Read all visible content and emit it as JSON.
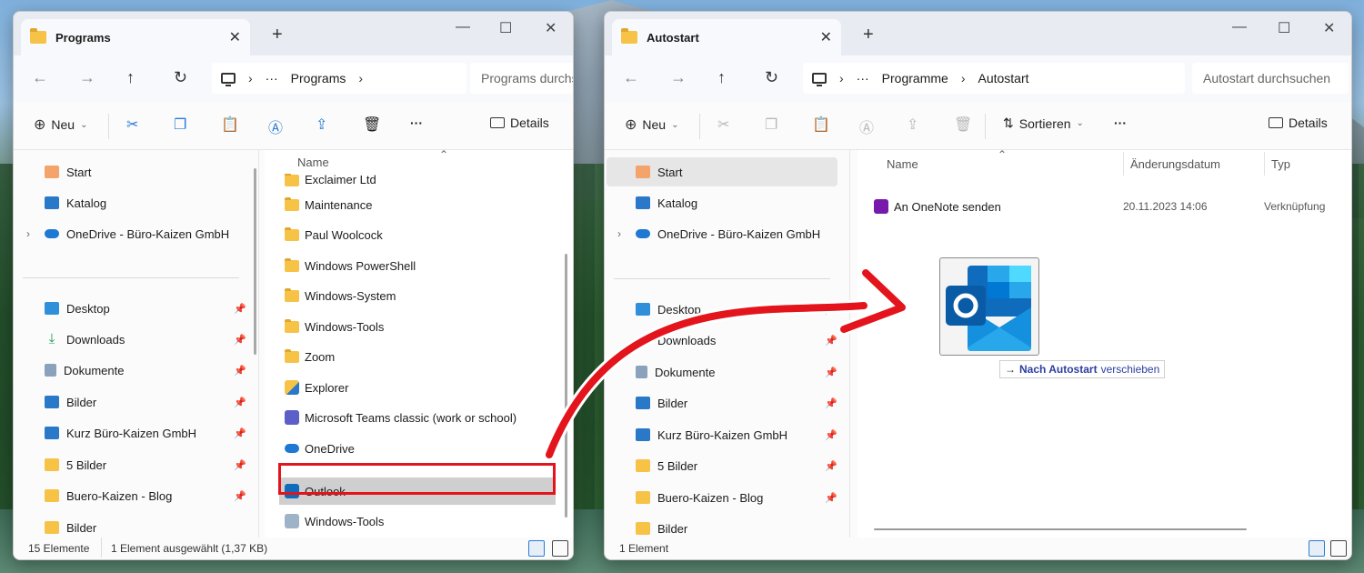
{
  "left_window": {
    "tab_title": "Programs",
    "breadcrumb": [
      "Programs"
    ],
    "search_placeholder": "Programs durchsuchen",
    "toolbar": {
      "new_label": "Neu",
      "details_label": "Details"
    },
    "sidebar": {
      "top": [
        {
          "label": "Start",
          "icon": "home-icon"
        },
        {
          "label": "Katalog",
          "icon": "gallery-icon"
        },
        {
          "label": "OneDrive - Büro-Kaizen GmbH",
          "icon": "onedrive-icon"
        }
      ],
      "pinned": [
        {
          "label": "Desktop",
          "icon": "desktop-icon"
        },
        {
          "label": "Downloads",
          "icon": "downloads-icon"
        },
        {
          "label": "Dokumente",
          "icon": "documents-icon"
        },
        {
          "label": "Bilder",
          "icon": "pictures-icon"
        },
        {
          "label": "Kurz Büro-Kaizen GmbH",
          "icon": "pictures-icon"
        },
        {
          "label": "5 Bilder",
          "icon": "folder-icon"
        },
        {
          "label": "Buero-Kaizen - Blog",
          "icon": "folder-icon"
        },
        {
          "label": "Bilder",
          "icon": "folder-icon"
        }
      ]
    },
    "column_name": "Name",
    "files": [
      {
        "name": "Exclaimer Ltd",
        "type": "folder"
      },
      {
        "name": "Maintenance",
        "type": "folder"
      },
      {
        "name": "Paul Woolcock",
        "type": "folder"
      },
      {
        "name": "Windows PowerShell",
        "type": "folder"
      },
      {
        "name": "Windows-System",
        "type": "folder"
      },
      {
        "name": "Windows-Tools",
        "type": "folder"
      },
      {
        "name": "Zoom",
        "type": "folder"
      },
      {
        "name": "Explorer",
        "type": "shortcut"
      },
      {
        "name": "Microsoft Teams classic (work or school)",
        "type": "teams"
      },
      {
        "name": "OneDrive",
        "type": "onedrive"
      },
      {
        "name": "Outlook",
        "type": "outlook"
      },
      {
        "name": "Windows-Tools",
        "type": "shortcut"
      }
    ],
    "status": {
      "count": "15 Elemente",
      "selection": "1 Element ausgewählt (1,37 KB)"
    }
  },
  "right_window": {
    "tab_title": "Autostart",
    "breadcrumb": [
      "Programme",
      "Autostart"
    ],
    "search_placeholder": "Autostart durchsuchen",
    "toolbar": {
      "new_label": "Neu",
      "sort_label": "Sortieren",
      "details_label": "Details"
    },
    "sidebar": {
      "top": [
        {
          "label": "Start",
          "icon": "home-icon"
        },
        {
          "label": "Katalog",
          "icon": "gallery-icon"
        },
        {
          "label": "OneDrive - Büro-Kaizen GmbH",
          "icon": "onedrive-icon"
        }
      ],
      "pinned": [
        {
          "label": "Desktop",
          "icon": "desktop-icon"
        },
        {
          "label": "Downloads",
          "icon": "downloads-icon"
        },
        {
          "label": "Dokumente",
          "icon": "documents-icon"
        },
        {
          "label": "Bilder",
          "icon": "pictures-icon"
        },
        {
          "label": "Kurz Büro-Kaizen GmbH",
          "icon": "pictures-icon"
        },
        {
          "label": "5 Bilder",
          "icon": "folder-icon"
        },
        {
          "label": "Buero-Kaizen - Blog",
          "icon": "folder-icon"
        },
        {
          "label": "Bilder",
          "icon": "folder-icon"
        }
      ]
    },
    "columns": {
      "name": "Name",
      "date": "Änderungsdatum",
      "type": "Typ"
    },
    "files": [
      {
        "name": "An OneNote senden",
        "date": "20.11.2023 14:06",
        "type": "Verknüpfung"
      }
    ],
    "drag_tooltip": {
      "action": "Nach Autostart",
      "verb": "verschieben"
    },
    "status": {
      "count": "1 Element"
    }
  },
  "colors": {
    "highlight": "#e3141b",
    "accent": "#2b7bd6"
  }
}
